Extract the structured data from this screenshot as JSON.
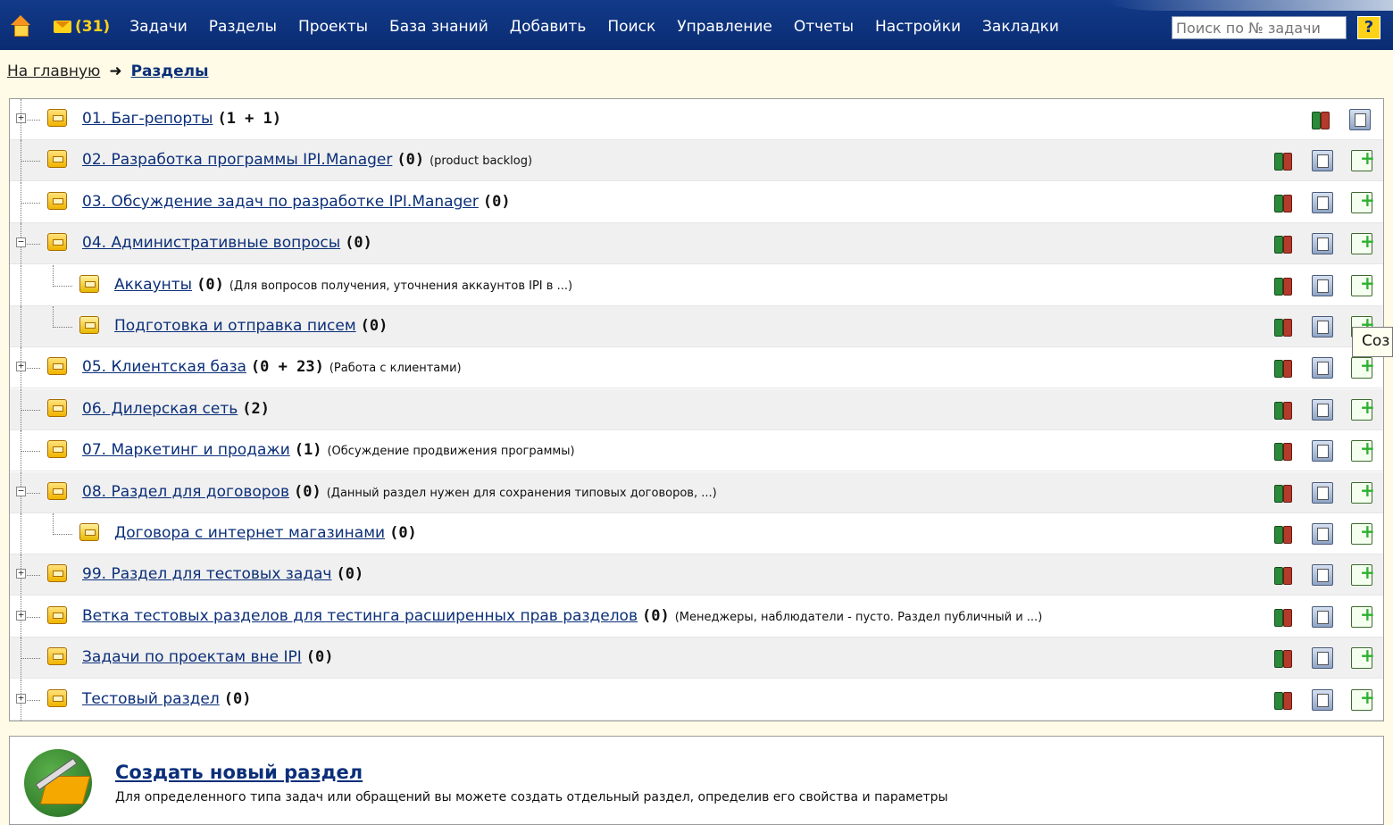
{
  "nav": {
    "mail_count": "(31)",
    "items": [
      "Задачи",
      "Разделы",
      "Проекты",
      "База знаний",
      "Добавить",
      "Поиск",
      "Управление",
      "Отчеты",
      "Настройки",
      "Закладки"
    ],
    "search_placeholder": "Поиск по № задачи",
    "help_label": "?"
  },
  "breadcrumb": {
    "home": "На главную",
    "arrow": "➜",
    "current": "Разделы"
  },
  "sections": [
    {
      "name": "01. Баг-репорты",
      "count": "(1 + 1)",
      "desc": "",
      "level": 0,
      "expander": "+"
    },
    {
      "name": "02. Разработка программы IPI.Manager",
      "count": "(0)",
      "desc": "(product backlog)",
      "level": 0,
      "expander": ""
    },
    {
      "name": "03. Обсуждение задач по разработке IPI.Manager",
      "count": "(0)",
      "desc": "",
      "level": 0,
      "expander": ""
    },
    {
      "name": "04. Административные вопросы",
      "count": "(0)",
      "desc": "",
      "level": 0,
      "expander": "−"
    },
    {
      "name": "Аккаунты",
      "count": "(0)",
      "desc": "(Для вопросов получения, уточнения аккаунтов IPI в ...)",
      "level": 1,
      "expander": ""
    },
    {
      "name": "Подготовка и отправка писем",
      "count": "(0)",
      "desc": "",
      "level": 1,
      "expander": ""
    },
    {
      "name": "05. Клиентская база",
      "count": "(0 + 23)",
      "desc": "(Работа с клиентами)",
      "level": 0,
      "expander": "+"
    },
    {
      "name": "06. Дилерская сеть",
      "count": "(2)",
      "desc": "",
      "level": 0,
      "expander": ""
    },
    {
      "name": "07. Маркетинг и продажи",
      "count": "(1)",
      "desc": "(Обсуждение продвижения программы)",
      "level": 0,
      "expander": ""
    },
    {
      "name": "08. Раздел для договоров",
      "count": "(0)",
      "desc": "(Данный раздел нужен для сохранения типовых договоров, ...)",
      "level": 0,
      "expander": "−"
    },
    {
      "name": "Договора с интернет магазинами",
      "count": "(0)",
      "desc": "",
      "level": 1,
      "expander": ""
    },
    {
      "name": "99. Раздел для тестовых задач",
      "count": "(0)",
      "desc": "",
      "level": 0,
      "expander": "+"
    },
    {
      "name": "Ветка тестовых разделов для тестинга расширенных прав разделов",
      "count": "(0)",
      "desc": "(Менеджеры, наблюдатели - пусто. Раздел публичный и ...)",
      "level": 0,
      "expander": "+"
    },
    {
      "name": "Задачи по проектам вне IPI",
      "count": "(0)",
      "desc": "",
      "level": 0,
      "expander": ""
    },
    {
      "name": "Тестовый раздел",
      "count": "(0)",
      "desc": "",
      "level": 0,
      "expander": "+"
    }
  ],
  "tooltip": "Соз",
  "create": {
    "title": "Создать новый раздел",
    "desc": "Для определенного типа задач или обращений вы можете создать отдельный раздел, определив его свойства и параметры"
  },
  "colors": {
    "nav_bg": "#0b2f79",
    "page_bg": "#fffbe6",
    "link": "#0b2f79",
    "mail": "#ffd21a"
  }
}
